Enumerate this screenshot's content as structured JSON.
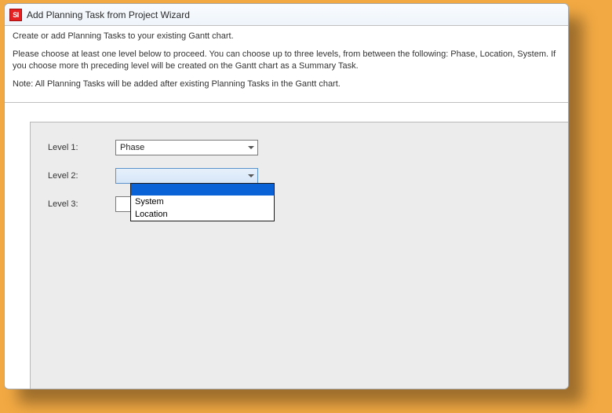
{
  "window": {
    "icon_text": "SI",
    "title": "Add Planning Task from Project Wizard"
  },
  "intro": {
    "line1": "Create or add Planning Tasks to your existing Gantt chart.",
    "line2": "Please choose at least one level below to proceed. You can choose up to three levels, from between the following: Phase, Location, System. If you choose more th preceding level will be created on the Gantt chart as a Summary Task.",
    "line3": "Note: All Planning Tasks will be added after existing Planning Tasks in the Gantt chart."
  },
  "form": {
    "level1": {
      "label": "Level 1:",
      "value": "Phase"
    },
    "level2": {
      "label": "Level 2:",
      "value": ""
    },
    "level3": {
      "label": "Level 3:",
      "value": ""
    }
  },
  "dropdown": {
    "opt_blank": "",
    "opt_system": "System",
    "opt_location": "Location"
  }
}
